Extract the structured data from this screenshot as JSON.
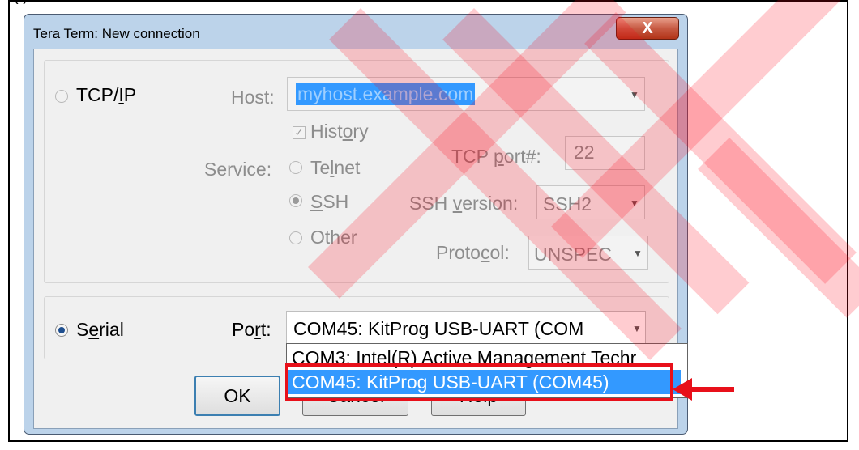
{
  "window": {
    "title": "Tera Term: New connection",
    "close_glyph": "X"
  },
  "tcpip": {
    "label_pre": "TCP/",
    "label_acc": "I",
    "label_post": "P",
    "host_label": "Host:",
    "host_value": "myhost.example.com",
    "history_label_pre": "Hist",
    "history_label_acc": "o",
    "history_label_post": "ry",
    "service_label": "Service:",
    "telnet_pre": "Te",
    "telnet_acc": "l",
    "telnet_post": "net",
    "ssh_acc": "S",
    "ssh_post": "SH",
    "other_label": "Other",
    "tcpport_pre": "TCP ",
    "tcpport_acc": "p",
    "tcpport_post": "ort#:",
    "tcpport_value": "22",
    "sshver_pre": "SSH ",
    "sshver_acc": "v",
    "sshver_post": "ersion:",
    "sshver_value": "SSH2",
    "protocol_pre": "Proto",
    "protocol_acc": "c",
    "protocol_post": "ol:",
    "protocol_value": "UNSPEC"
  },
  "serial": {
    "label_pre": "S",
    "label_acc": "e",
    "label_post": "rial",
    "port_pre": "Po",
    "port_acc": "r",
    "port_post": "t:",
    "port_value": "COM45: KitProg USB-UART (COM",
    "options": [
      "COM3: Intel(R) Active Management Techr",
      "COM45: KitProg USB-UART (COM45)"
    ]
  },
  "buttons": {
    "ok": "OK",
    "cancel": "Cancel",
    "help": "Help"
  },
  "top_fragment": "(        )",
  "colors": {
    "annotation_red": "#e8101a",
    "selection_blue": "#3399ff"
  }
}
